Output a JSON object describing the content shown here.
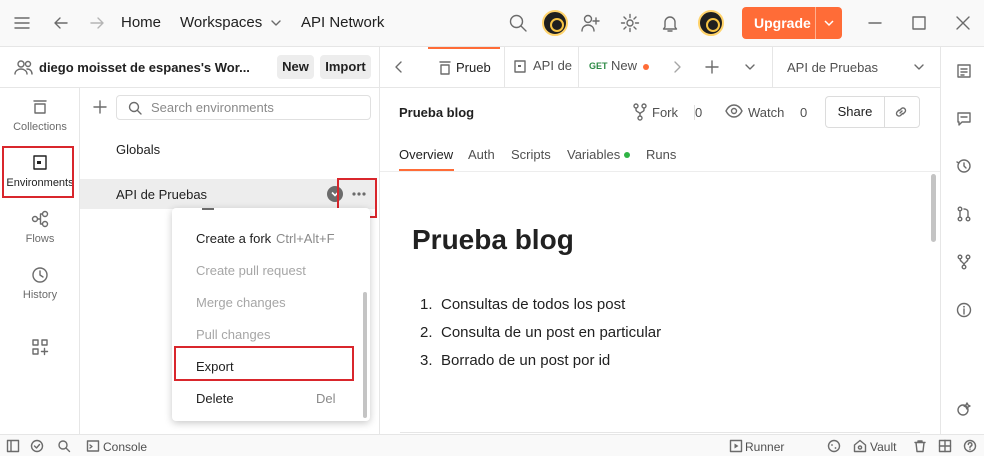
{
  "topbar": {
    "home": "Home",
    "workspaces": "Workspaces",
    "api_network": "API Network",
    "upgrade": "Upgrade"
  },
  "workspace": {
    "name": "diego moisset de espanes's Wor...",
    "new_label": "New",
    "import_label": "Import"
  },
  "rail": {
    "collections": "Collections",
    "environments": "Environments",
    "flows": "Flows",
    "history": "History"
  },
  "environments": {
    "search_placeholder": "Search environments",
    "globals": "Globals",
    "selected": "API de Pruebas"
  },
  "context_menu": {
    "items": [
      {
        "label": "Create a fork",
        "shortcut": "Ctrl+Alt+F",
        "disabled": false
      },
      {
        "label": "Create pull request",
        "disabled": true
      },
      {
        "label": "Merge changes",
        "disabled": true
      },
      {
        "label": "Pull changes",
        "disabled": true
      },
      {
        "label": "Export",
        "disabled": false
      },
      {
        "label": "Delete",
        "shortcut": "Del",
        "disabled": false
      }
    ]
  },
  "tabs": {
    "tab1": "Prueb",
    "tab2": "API de",
    "tab3_method": "GET",
    "tab3": "New",
    "environment_selector": "API de Pruebas"
  },
  "doc": {
    "header_title": "Prueba blog",
    "fork_label": "Fork",
    "fork_count": "0",
    "watch_label": "Watch",
    "watch_count": "0",
    "share_label": "Share",
    "subtabs": [
      "Overview",
      "Auth",
      "Scripts",
      "Variables",
      "Runs"
    ],
    "title": "Prueba blog",
    "list": [
      {
        "num": "1.",
        "text": "Consultas de todos los post"
      },
      {
        "num": "2.",
        "text": "Consulta de un post en particular"
      },
      {
        "num": "3.",
        "text": "Borrado de un post por id"
      }
    ]
  },
  "statusbar": {
    "console": "Console",
    "runner": "Runner",
    "vault": "Vault"
  },
  "colors": {
    "accent": "#ff6c37",
    "highlight_box": "#d9262c",
    "variables_dot": "#2fb344"
  }
}
